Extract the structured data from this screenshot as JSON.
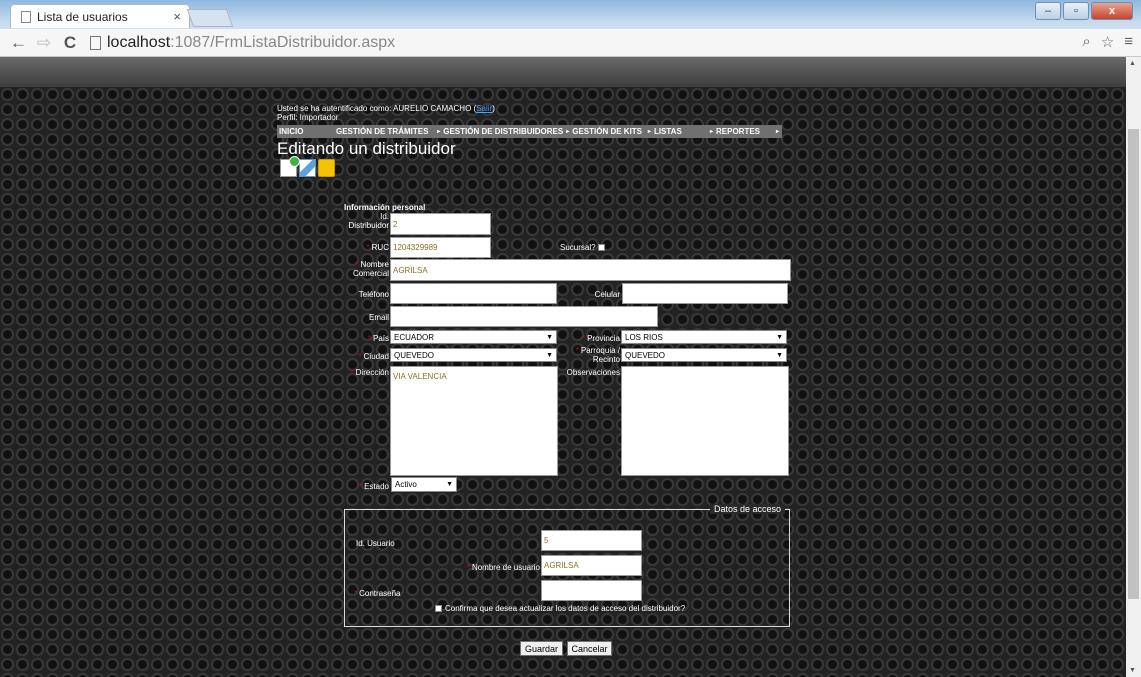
{
  "browser": {
    "tab_title": "Lista de usuarios",
    "tab_close": "×",
    "url_host": "localhost",
    "url_path": ":1087/FrmListaDistribuidor.aspx",
    "win_min": "–",
    "win_max": "▫",
    "win_close": "x",
    "back": "←",
    "forward": "⇨",
    "reload": "C",
    "zoom": "⌕",
    "star": "☆",
    "menu": "≡"
  },
  "header": {
    "auth_prefix": "Usted se ha autentificado como: AURELIO CAMACHO (",
    "auth_link": "Salir",
    "auth_suffix": ")",
    "profile": "Perfil: Importador"
  },
  "menu": {
    "items": [
      "INICIO",
      "GESTIÓN DE TRÁMITES",
      "GESTIÓN DE DISTRIBUIDORES",
      "GESTIÓN DE KITS",
      "LISTAS",
      "REPORTES"
    ],
    "arrow": "▸"
  },
  "page_title": "Editando un distribuidor",
  "form": {
    "section": "Información personal",
    "labels": {
      "id": "Id. Distribuidor",
      "ruc": "RUC",
      "sucursal": "Sucursal?",
      "nombre": "Nombre Comercial",
      "telefono": "Teléfono",
      "celular": "Celular",
      "email": "Email",
      "pais": "País",
      "provincia": "Provincia",
      "ciudad": "Ciudad",
      "parroquia": "Parroquia / Recinto",
      "direccion": "Dirección",
      "observaciones": "Observaciones",
      "estado": "Estado"
    },
    "required_mark": "*",
    "values": {
      "id": "2",
      "ruc": "1204329989",
      "nombre": "AGRILSA",
      "telefono": "",
      "celular": "",
      "email": "",
      "pais": "ECUADOR",
      "provincia": "LOS RIOS",
      "ciudad": "QUEVEDO",
      "parroquia": "QUEVEDO",
      "direccion": "VIA VALENCIA",
      "observaciones": "",
      "estado": "Activo"
    },
    "dropdown_arrow": "▼"
  },
  "access": {
    "legend": "Datos de acceso",
    "id_label": "Id. Usuario",
    "id_value": "5",
    "user_label": "Nombre de usuario",
    "user_value": "AGRILSA",
    "pass_label": "Contraseña",
    "pass_value": "",
    "confirm_label": "Confirma que desea actualizar los datos de acceso del distribuidor?"
  },
  "buttons": {
    "save": "Guardar",
    "cancel": "Cancelar"
  },
  "colors": {
    "menu_bg": "#707070",
    "link": "#4aa3ff",
    "required": "#d00000",
    "input_text": "#8a6f1e"
  }
}
